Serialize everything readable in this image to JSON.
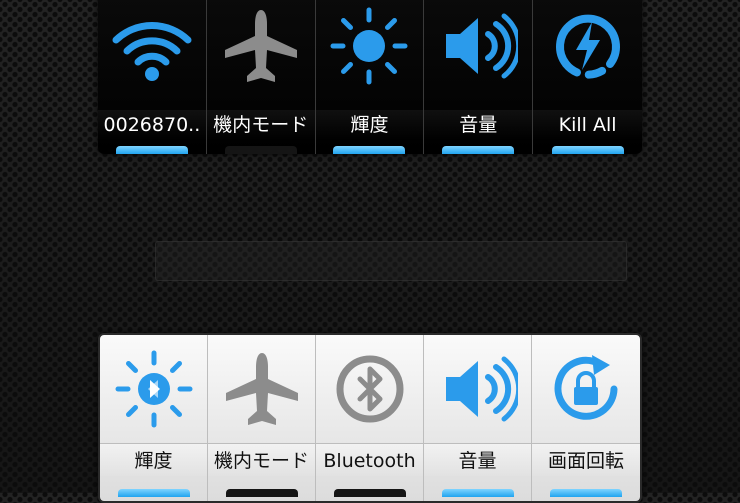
{
  "colors": {
    "accent": "#2B9BEB",
    "inactive_icon": "#8C8C8C",
    "dark_label": "#FFFFFF",
    "light_label": "#111111"
  },
  "top_widget": {
    "tiles": [
      {
        "label": "0026870..",
        "icon": "wifi-icon",
        "state": "on"
      },
      {
        "label": "機内モード",
        "icon": "airplane-icon",
        "state": "off"
      },
      {
        "label": "輝度",
        "icon": "brightness-icon",
        "state": "on"
      },
      {
        "label": "音量",
        "icon": "volume-icon",
        "state": "on"
      },
      {
        "label": "Kill All",
        "icon": "kill-all-icon",
        "state": "on"
      }
    ]
  },
  "bottom_widget": {
    "tiles": [
      {
        "label": "輝度",
        "icon": "brightness-auto-icon",
        "state": "on"
      },
      {
        "label": "機内モード",
        "icon": "airplane-icon",
        "state": "off"
      },
      {
        "label": "Bluetooth",
        "icon": "bluetooth-icon",
        "state": "off"
      },
      {
        "label": "音量",
        "icon": "volume-icon",
        "state": "on"
      },
      {
        "label": "画面回転",
        "icon": "rotation-lock-icon",
        "state": "on"
      }
    ]
  }
}
